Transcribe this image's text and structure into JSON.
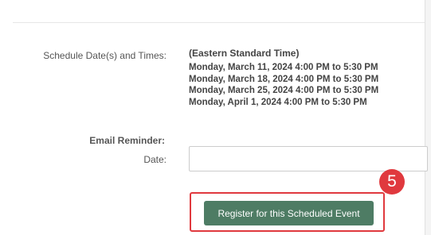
{
  "schedule": {
    "label": "Schedule Date(s) and Times:",
    "timezone": "(Eastern Standard Time)",
    "dates": [
      "Monday, March 11, 2024 4:00 PM to 5:30 PM",
      "Monday, March 18, 2024 4:00 PM to 5:30 PM",
      "Monday, March 25, 2024 4:00 PM to 5:30 PM",
      "Monday, April 1, 2024 4:00 PM to 5:30 PM"
    ]
  },
  "reminder": {
    "label": "Email Reminder:",
    "date_label": "Date:",
    "date_value": ""
  },
  "register": {
    "button_label": "Register for this Scheduled Event"
  },
  "callout": {
    "step_number": "5",
    "color": "#e0393e"
  },
  "colors": {
    "button_bg": "#4e7c64",
    "label_text": "#555555",
    "date_text": "#444444"
  }
}
